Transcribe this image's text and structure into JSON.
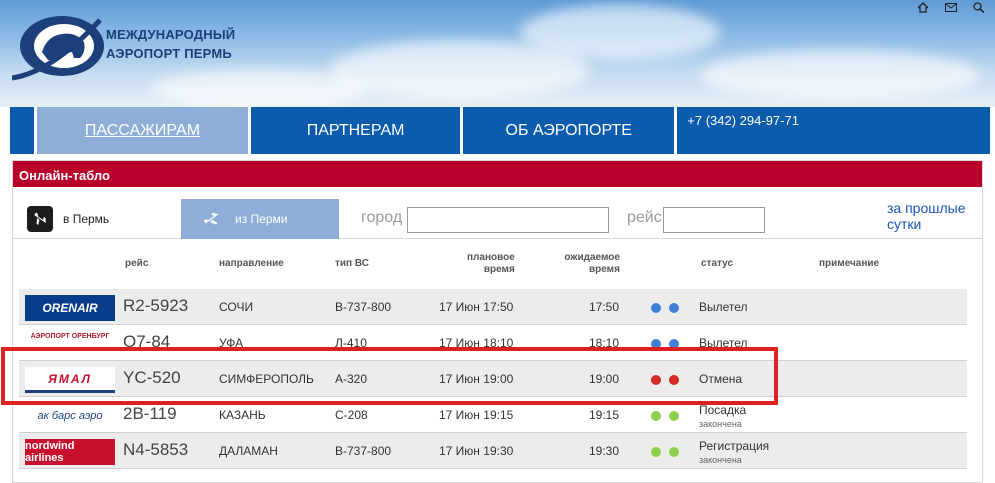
{
  "header": {
    "logo_line1": "МЕЖДУНАРОДНЫЙ",
    "logo_line2": "АЭРОПОРТ ПЕРМЬ",
    "icons": [
      "home-icon",
      "mail-icon",
      "search-icon"
    ]
  },
  "nav": {
    "items": [
      {
        "label": "ПАССАЖИРАМ",
        "active": true
      },
      {
        "label": "ПАРТНЕРАМ",
        "active": false
      },
      {
        "label": "ОБ АЭРОПОРТЕ",
        "active": false
      }
    ],
    "phone": "+7 (342) 294-97-71"
  },
  "board": {
    "title": "Онлайн-табло",
    "tab_in": "в Пермь",
    "tab_out": "из Перми",
    "city_label": "город",
    "flight_label": "рейс",
    "prev_line1": "за прошлые",
    "prev_line2": "сутки",
    "columns": {
      "flight": "рейс",
      "dest": "направление",
      "type": "тип ВС",
      "sched1": "плановое",
      "sched2": "время",
      "exp1": "ожидаемое",
      "exp2": "время",
      "status": "статус",
      "note": "примечание"
    },
    "rows": [
      {
        "airline": "ORENAIR",
        "flight": "R2-5923",
        "dest": "СОЧИ",
        "type": "B-737-800",
        "sched": "17 Июн 17:50",
        "exp": "17:50",
        "status": "Вылетел",
        "substatus": "",
        "dot_color": "#3f7fd6"
      },
      {
        "airline": "АЭРОПОРТ ОРЕНБУРГ",
        "flight": "O7-84",
        "dest": "УФА",
        "type": "Л-410",
        "sched": "17 Июн 18:10",
        "exp": "18:10",
        "status": "Вылетел",
        "substatus": "",
        "dot_color": "#3f7fd6"
      },
      {
        "airline": "ЯМАЛ",
        "flight": "YC-520",
        "dest": "СИМФЕРОПОЛЬ",
        "type": "A-320",
        "sched": "17 Июн 19:00",
        "exp": "19:00",
        "status": "Отмена",
        "substatus": "",
        "dot_color": "#d42a2a"
      },
      {
        "airline": "ак барс аэро",
        "flight": "2B-119",
        "dest": "КАЗАНЬ",
        "type": "C-208",
        "sched": "17 Июн 19:15",
        "exp": "19:15",
        "status": "Посадка",
        "substatus": "закончена",
        "dot_color": "#8fd14f"
      },
      {
        "airline": "nordwind airlines",
        "flight": "N4-5853",
        "dest": "ДАЛАМАН",
        "type": "B-737-800",
        "sched": "17 Июн 19:30",
        "exp": "19:30",
        "status": "Регистрация",
        "substatus": "закончена",
        "dot_color": "#8fd14f"
      }
    ]
  }
}
